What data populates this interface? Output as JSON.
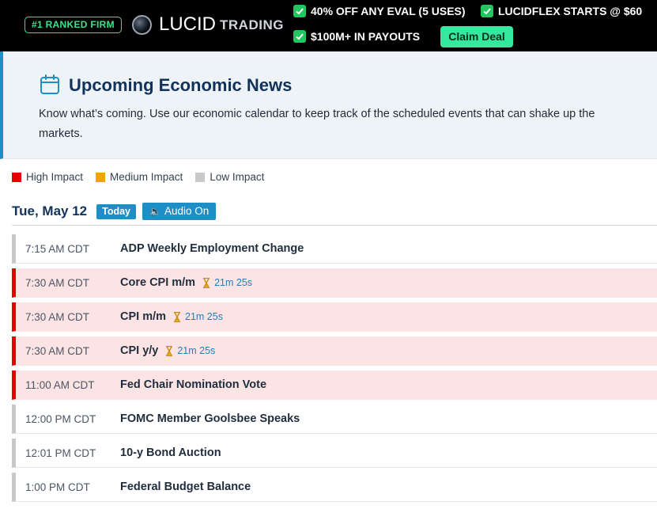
{
  "banner": {
    "rank_badge": "#1 RANKED FIRM",
    "logo_name": "LUCID",
    "logo_sub": "TRADING",
    "promos": [
      "40% OFF ANY EVAL (5 USES)",
      "LUCIDFLEX STARTS @ $60",
      "$100M+ IN PAYOUTS"
    ],
    "claim_label": "Claim Deal",
    "accent": "#34e89e"
  },
  "header": {
    "title": "Upcoming Economic News",
    "description": "Know what’s coming. Use our economic calendar to keep track of the scheduled events that can shake up the markets."
  },
  "legend": [
    {
      "label": "High Impact",
      "color": "#e60000"
    },
    {
      "label": "Medium Impact",
      "color": "#f0a500"
    },
    {
      "label": "Low Impact",
      "color": "#c8c8c8"
    }
  ],
  "date_bar": {
    "date": "Tue, May 12",
    "today_label": "Today",
    "audio_label": "Audio On"
  },
  "events": [
    {
      "time": "7:15 AM CDT",
      "name": "ADP Weekly Employment Change",
      "impact": "low",
      "countdown": ""
    },
    {
      "time": "7:30 AM CDT",
      "name": "Core CPI m/m",
      "impact": "high",
      "countdown": "21m 25s"
    },
    {
      "time": "7:30 AM CDT",
      "name": "CPI m/m",
      "impact": "high",
      "countdown": "21m 25s"
    },
    {
      "time": "7:30 AM CDT",
      "name": "CPI y/y",
      "impact": "high",
      "countdown": "21m 25s"
    },
    {
      "time": "11:00 AM CDT",
      "name": "Fed Chair Nomination Vote",
      "impact": "high",
      "countdown": ""
    },
    {
      "time": "12:00 PM CDT",
      "name": "FOMC Member Goolsbee Speaks",
      "impact": "low",
      "countdown": ""
    },
    {
      "time": "12:01 PM CDT",
      "name": "10-y Bond Auction",
      "impact": "low",
      "countdown": ""
    },
    {
      "time": "1:00 PM CDT",
      "name": "Federal Budget Balance",
      "impact": "low",
      "countdown": ""
    }
  ]
}
